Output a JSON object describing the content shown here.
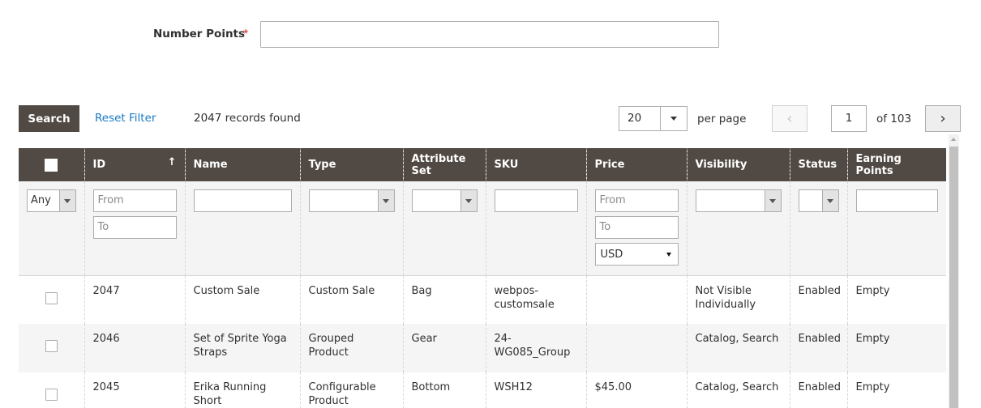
{
  "form": {
    "number_points_label": "Number Points",
    "required_mark": "*",
    "number_points_value": ""
  },
  "toolbar": {
    "search_label": "Search",
    "reset_label": "Reset Filter",
    "records_text": "2047 records found",
    "per_page_value": "20",
    "per_page_label": "per page",
    "current_page": "1",
    "of_pages": "of 103"
  },
  "columns": {
    "id": "ID",
    "name": "Name",
    "type": "Type",
    "attribute_set": "Attribute Set",
    "sku": "SKU",
    "price": "Price",
    "visibility": "Visibility",
    "status": "Status",
    "earning_points": "Earning Points",
    "sort_indicator": "↑"
  },
  "filters": {
    "in_products": "Any",
    "id_from_placeholder": "From",
    "id_to_placeholder": "To",
    "price_from_placeholder": "From",
    "price_to_placeholder": "To",
    "currency": "USD"
  },
  "rows": [
    {
      "id": "2047",
      "name": "Custom Sale",
      "type": "Custom Sale",
      "attribute_set": "Bag",
      "sku": "webpos-customsale",
      "price": "",
      "visibility": "Not Visible Individually",
      "status": "Enabled",
      "earning_points": "Empty"
    },
    {
      "id": "2046",
      "name": "Set of Sprite Yoga Straps",
      "type": "Grouped Product",
      "attribute_set": "Gear",
      "sku": "24-WG085_Group",
      "price": "",
      "visibility": "Catalog, Search",
      "status": "Enabled",
      "earning_points": "Empty"
    },
    {
      "id": "2045",
      "name": "Erika Running Short",
      "type": "Configurable Product",
      "attribute_set": "Bottom",
      "sku": "WSH12",
      "price": "$45.00",
      "visibility": "Catalog, Search",
      "status": "Enabled",
      "earning_points": "Empty"
    }
  ]
}
